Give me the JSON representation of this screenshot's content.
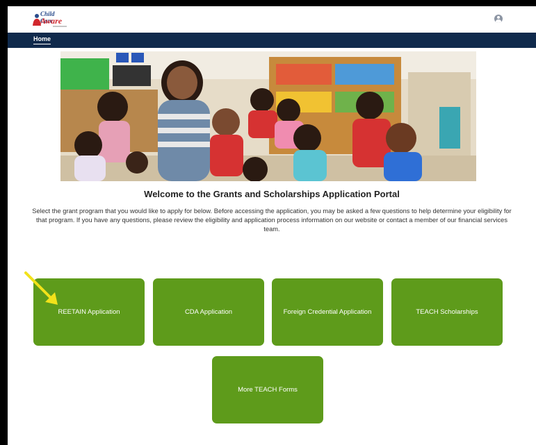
{
  "header": {
    "logo_line1": "Child Care",
    "logo_line2": "Aware",
    "nav_home": "Home"
  },
  "main": {
    "title": "Welcome to the Grants and Scholarships Application Portal",
    "intro": "Select the grant program that you would like to apply for below. Before accessing the application, you may be asked a few questions to help determine your eligibility for that program. If you have any questions, please review the eligibility and application process information on our website or contact a member of our financial services team."
  },
  "buttons": [
    {
      "label": "REETAIN Application"
    },
    {
      "label": "CDA Application"
    },
    {
      "label": "Foreign Credential Application"
    },
    {
      "label": "TEACH Scholarships"
    },
    {
      "label": "More TEACH Forms"
    }
  ],
  "colors": {
    "button_green": "#5e9b1b",
    "navbar": "#102a4c",
    "arrow": "#f2e21a"
  }
}
